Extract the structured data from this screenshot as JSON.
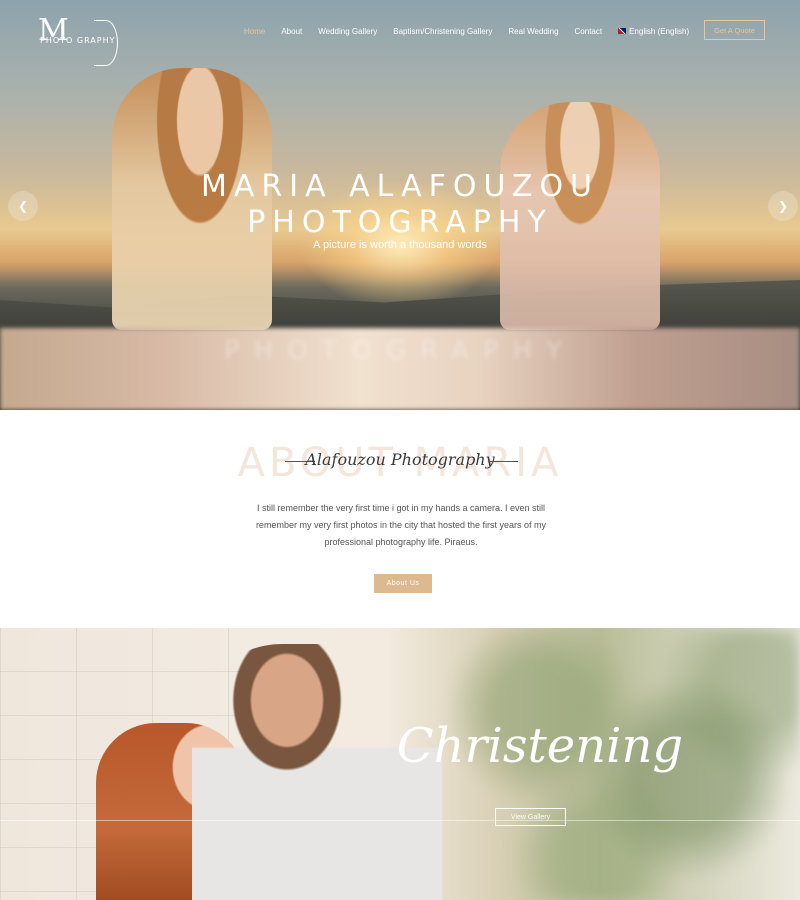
{
  "logo": {
    "mark": "M",
    "text": "PHOTO GRAPHY"
  },
  "nav": {
    "items": [
      "Home",
      "About",
      "Wedding Gallery",
      "Baptism/Christening Gallery",
      "Real Wedding",
      "Contact",
      "English (English)"
    ],
    "active": "Home",
    "cta_label": "Get A Quote"
  },
  "hero": {
    "title_line1": "MARIA ALAFOUZOU",
    "title_line2": "PHOTOGRAPHY",
    "subtitle": "A picture is worth a thousand words",
    "prev_icon": "chevron-left-icon",
    "next_icon": "chevron-right-icon"
  },
  "about": {
    "ghost_title": "ABOUT MARIA",
    "script_title": "Alafouzou Photography",
    "body": "I still remember the very first time i got in my hands a camera. I even still remember my very first photos in the city that hosted the first years of my professional photography life. Piraeus.",
    "button_label": "About Us"
  },
  "christening": {
    "title": "Christening",
    "button_label": "View Gallery"
  },
  "colors": {
    "accent": "#dcb98f",
    "accent_light": "#e7c79c"
  }
}
